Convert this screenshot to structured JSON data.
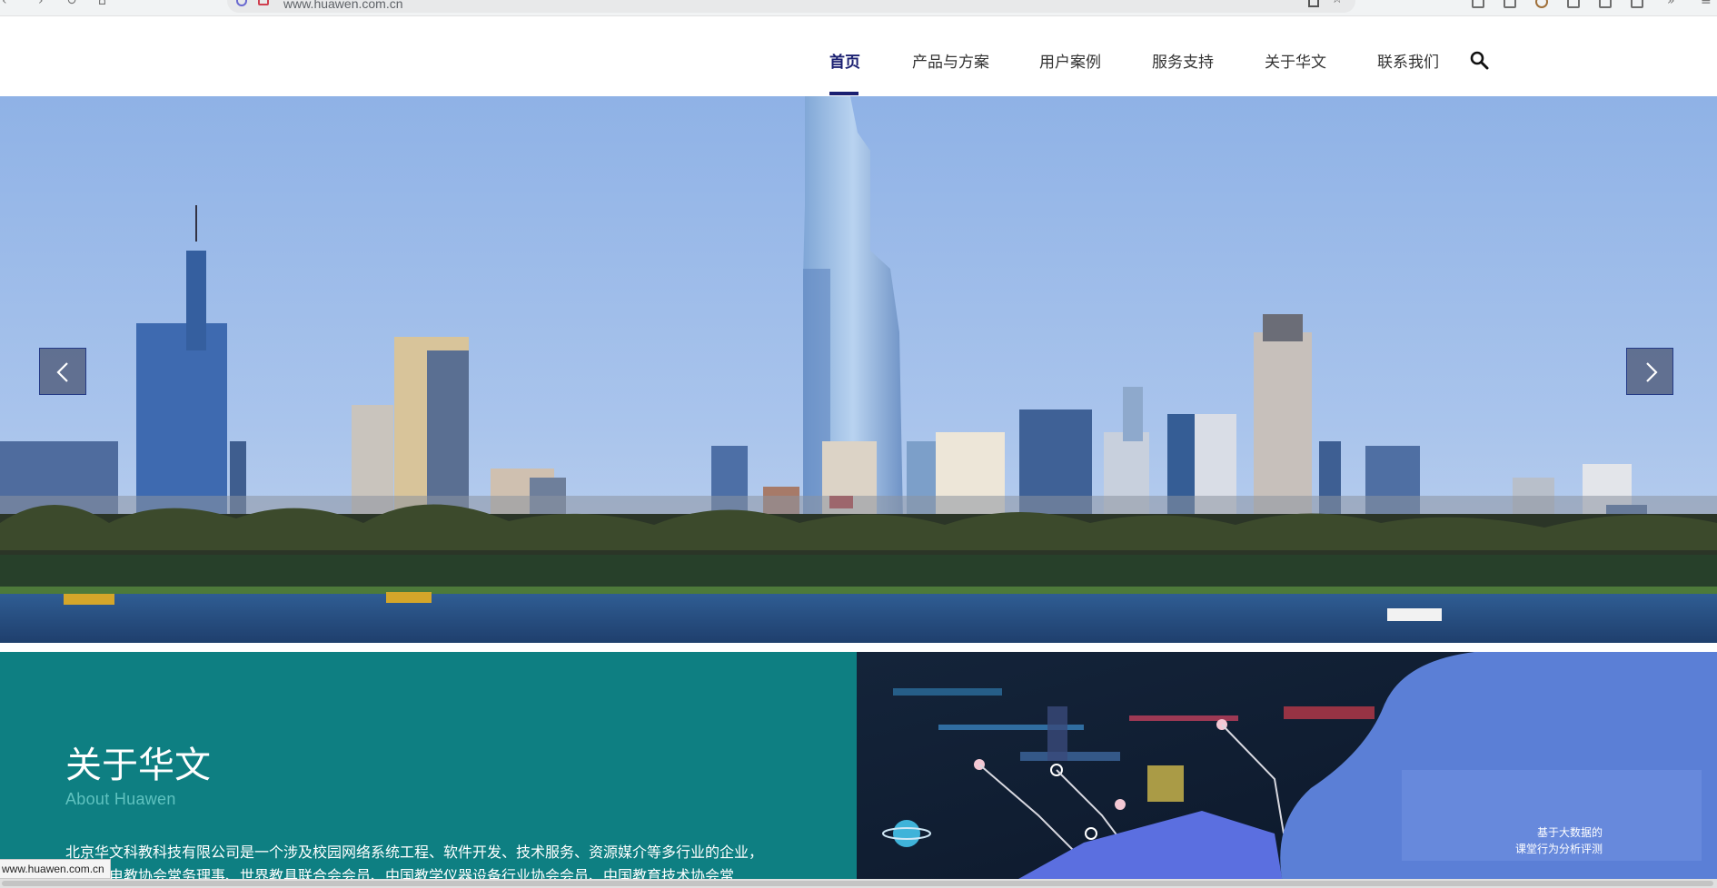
{
  "browser": {
    "url": "www.huawen.com.cn"
  },
  "nav": {
    "items": [
      {
        "label": "首页",
        "active": true
      },
      {
        "label": "产品与方案",
        "active": false
      },
      {
        "label": "用户案例",
        "active": false
      },
      {
        "label": "服务支持",
        "active": false
      },
      {
        "label": "关于华文",
        "active": false
      },
      {
        "label": "联系我们",
        "active": false
      }
    ],
    "search_icon": "search-icon"
  },
  "hero": {
    "image": "city-skyline-lake",
    "prev_icon": "chevron-left-icon",
    "next_icon": "chevron-right-icon"
  },
  "about": {
    "title": "关于华文",
    "subtitle": "About Huawen",
    "line1": "北京华文科教科技有限公司是一个涉及校园网络系统工程、软件开发、技术服务、资源媒介等多行业的企业，",
    "line2": "是中国电教协会常务理事、世界教具联合会会员、中国教学仪器设备行业协会会员、中国教育技术协会常"
  },
  "poster": {
    "line1": "基于大数据的",
    "line2": "课堂行为分析评测"
  },
  "status_bar": {
    "url": "www.huawen.com.cn"
  },
  "colors": {
    "nav_active": "#1a1f71",
    "about_bg": "#0e7f82",
    "about_subtitle": "#5fc2bf"
  }
}
